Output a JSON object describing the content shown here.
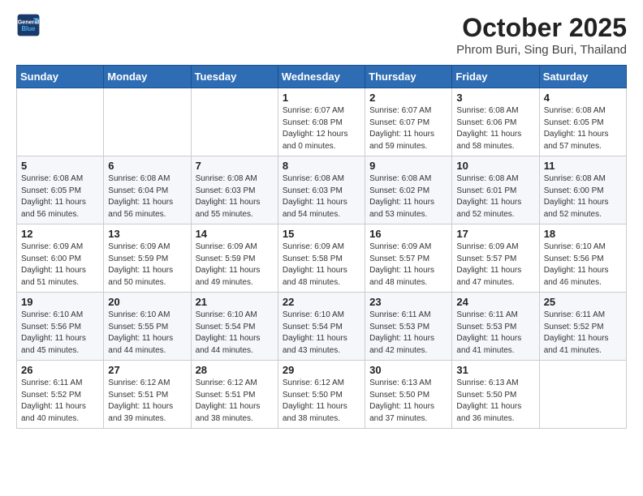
{
  "header": {
    "logo_line1": "General",
    "logo_line2": "Blue",
    "title": "October 2025",
    "subtitle": "Phrom Buri, Sing Buri, Thailand"
  },
  "weekdays": [
    "Sunday",
    "Monday",
    "Tuesday",
    "Wednesday",
    "Thursday",
    "Friday",
    "Saturday"
  ],
  "weeks": [
    [
      {
        "day": "",
        "sunrise": "",
        "sunset": "",
        "daylight": ""
      },
      {
        "day": "",
        "sunrise": "",
        "sunset": "",
        "daylight": ""
      },
      {
        "day": "",
        "sunrise": "",
        "sunset": "",
        "daylight": ""
      },
      {
        "day": "1",
        "sunrise": "Sunrise: 6:07 AM",
        "sunset": "Sunset: 6:08 PM",
        "daylight": "Daylight: 12 hours and 0 minutes."
      },
      {
        "day": "2",
        "sunrise": "Sunrise: 6:07 AM",
        "sunset": "Sunset: 6:07 PM",
        "daylight": "Daylight: 11 hours and 59 minutes."
      },
      {
        "day": "3",
        "sunrise": "Sunrise: 6:08 AM",
        "sunset": "Sunset: 6:06 PM",
        "daylight": "Daylight: 11 hours and 58 minutes."
      },
      {
        "day": "4",
        "sunrise": "Sunrise: 6:08 AM",
        "sunset": "Sunset: 6:05 PM",
        "daylight": "Daylight: 11 hours and 57 minutes."
      }
    ],
    [
      {
        "day": "5",
        "sunrise": "Sunrise: 6:08 AM",
        "sunset": "Sunset: 6:05 PM",
        "daylight": "Daylight: 11 hours and 56 minutes."
      },
      {
        "day": "6",
        "sunrise": "Sunrise: 6:08 AM",
        "sunset": "Sunset: 6:04 PM",
        "daylight": "Daylight: 11 hours and 56 minutes."
      },
      {
        "day": "7",
        "sunrise": "Sunrise: 6:08 AM",
        "sunset": "Sunset: 6:03 PM",
        "daylight": "Daylight: 11 hours and 55 minutes."
      },
      {
        "day": "8",
        "sunrise": "Sunrise: 6:08 AM",
        "sunset": "Sunset: 6:03 PM",
        "daylight": "Daylight: 11 hours and 54 minutes."
      },
      {
        "day": "9",
        "sunrise": "Sunrise: 6:08 AM",
        "sunset": "Sunset: 6:02 PM",
        "daylight": "Daylight: 11 hours and 53 minutes."
      },
      {
        "day": "10",
        "sunrise": "Sunrise: 6:08 AM",
        "sunset": "Sunset: 6:01 PM",
        "daylight": "Daylight: 11 hours and 52 minutes."
      },
      {
        "day": "11",
        "sunrise": "Sunrise: 6:08 AM",
        "sunset": "Sunset: 6:00 PM",
        "daylight": "Daylight: 11 hours and 52 minutes."
      }
    ],
    [
      {
        "day": "12",
        "sunrise": "Sunrise: 6:09 AM",
        "sunset": "Sunset: 6:00 PM",
        "daylight": "Daylight: 11 hours and 51 minutes."
      },
      {
        "day": "13",
        "sunrise": "Sunrise: 6:09 AM",
        "sunset": "Sunset: 5:59 PM",
        "daylight": "Daylight: 11 hours and 50 minutes."
      },
      {
        "day": "14",
        "sunrise": "Sunrise: 6:09 AM",
        "sunset": "Sunset: 5:59 PM",
        "daylight": "Daylight: 11 hours and 49 minutes."
      },
      {
        "day": "15",
        "sunrise": "Sunrise: 6:09 AM",
        "sunset": "Sunset: 5:58 PM",
        "daylight": "Daylight: 11 hours and 48 minutes."
      },
      {
        "day": "16",
        "sunrise": "Sunrise: 6:09 AM",
        "sunset": "Sunset: 5:57 PM",
        "daylight": "Daylight: 11 hours and 48 minutes."
      },
      {
        "day": "17",
        "sunrise": "Sunrise: 6:09 AM",
        "sunset": "Sunset: 5:57 PM",
        "daylight": "Daylight: 11 hours and 47 minutes."
      },
      {
        "day": "18",
        "sunrise": "Sunrise: 6:10 AM",
        "sunset": "Sunset: 5:56 PM",
        "daylight": "Daylight: 11 hours and 46 minutes."
      }
    ],
    [
      {
        "day": "19",
        "sunrise": "Sunrise: 6:10 AM",
        "sunset": "Sunset: 5:56 PM",
        "daylight": "Daylight: 11 hours and 45 minutes."
      },
      {
        "day": "20",
        "sunrise": "Sunrise: 6:10 AM",
        "sunset": "Sunset: 5:55 PM",
        "daylight": "Daylight: 11 hours and 44 minutes."
      },
      {
        "day": "21",
        "sunrise": "Sunrise: 6:10 AM",
        "sunset": "Sunset: 5:54 PM",
        "daylight": "Daylight: 11 hours and 44 minutes."
      },
      {
        "day": "22",
        "sunrise": "Sunrise: 6:10 AM",
        "sunset": "Sunset: 5:54 PM",
        "daylight": "Daylight: 11 hours and 43 minutes."
      },
      {
        "day": "23",
        "sunrise": "Sunrise: 6:11 AM",
        "sunset": "Sunset: 5:53 PM",
        "daylight": "Daylight: 11 hours and 42 minutes."
      },
      {
        "day": "24",
        "sunrise": "Sunrise: 6:11 AM",
        "sunset": "Sunset: 5:53 PM",
        "daylight": "Daylight: 11 hours and 41 minutes."
      },
      {
        "day": "25",
        "sunrise": "Sunrise: 6:11 AM",
        "sunset": "Sunset: 5:52 PM",
        "daylight": "Daylight: 11 hours and 41 minutes."
      }
    ],
    [
      {
        "day": "26",
        "sunrise": "Sunrise: 6:11 AM",
        "sunset": "Sunset: 5:52 PM",
        "daylight": "Daylight: 11 hours and 40 minutes."
      },
      {
        "day": "27",
        "sunrise": "Sunrise: 6:12 AM",
        "sunset": "Sunset: 5:51 PM",
        "daylight": "Daylight: 11 hours and 39 minutes."
      },
      {
        "day": "28",
        "sunrise": "Sunrise: 6:12 AM",
        "sunset": "Sunset: 5:51 PM",
        "daylight": "Daylight: 11 hours and 38 minutes."
      },
      {
        "day": "29",
        "sunrise": "Sunrise: 6:12 AM",
        "sunset": "Sunset: 5:50 PM",
        "daylight": "Daylight: 11 hours and 38 minutes."
      },
      {
        "day": "30",
        "sunrise": "Sunrise: 6:13 AM",
        "sunset": "Sunset: 5:50 PM",
        "daylight": "Daylight: 11 hours and 37 minutes."
      },
      {
        "day": "31",
        "sunrise": "Sunrise: 6:13 AM",
        "sunset": "Sunset: 5:50 PM",
        "daylight": "Daylight: 11 hours and 36 minutes."
      },
      {
        "day": "",
        "sunrise": "",
        "sunset": "",
        "daylight": ""
      }
    ]
  ]
}
